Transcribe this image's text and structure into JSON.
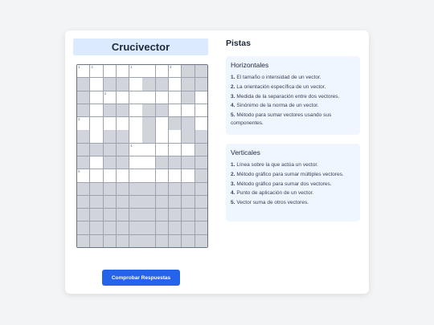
{
  "page": {
    "title": "Crucivector",
    "check_button_label": "Comprobar Respuestas"
  },
  "crossword": {
    "rows": 14,
    "cols": 10,
    "layout": [
      "WWWWWWWWGG",
      "GWGGWGGWGG",
      "GWWWWWWWGW",
      "GWGGWGGWWW",
      "WWWWWGWGGW",
      "GWGGWGWWGG",
      "GGGGWWWWWG",
      "GWGGWWGGGG",
      "WWWWWWWWWG",
      "GGGGGGGGGG",
      "GGGGGGGGGG",
      "GGGGGGGGGG",
      "GGGGGGGGGG",
      "GGGGGGGGGG"
    ],
    "numbers": [
      {
        "row": 0,
        "col": 0,
        "n": "1"
      },
      {
        "row": 0,
        "col": 1,
        "n": "4"
      },
      {
        "row": 0,
        "col": 4,
        "n": "1"
      },
      {
        "row": 0,
        "col": 7,
        "n": "3"
      },
      {
        "row": 2,
        "col": 2,
        "n": "2"
      },
      {
        "row": 4,
        "col": 0,
        "n": "3"
      },
      {
        "row": 6,
        "col": 4,
        "n": "4"
      },
      {
        "row": 8,
        "col": 0,
        "n": "5"
      }
    ]
  },
  "clues_panel": {
    "title": "Pistas",
    "horizontal": {
      "title": "Horizontales",
      "items": [
        {
          "n": "1.",
          "text": "El tamaño o intensidad de un vector."
        },
        {
          "n": "2.",
          "text": "La orientación específica de un vector."
        },
        {
          "n": "3.",
          "text": "Medida de la separación entre dos vectores."
        },
        {
          "n": "4.",
          "text": "Sinónimo de la norma de un vector."
        },
        {
          "n": "5.",
          "text": "Método para sumar vectores usando sus componentes."
        }
      ]
    },
    "vertical": {
      "title": "Verticales",
      "items": [
        {
          "n": "1.",
          "text": "Línea sobre la que actúa un vector."
        },
        {
          "n": "2.",
          "text": "Método gráfico para sumar múltiples vectores."
        },
        {
          "n": "3.",
          "text": "Método gráfico para sumar dos vectores."
        },
        {
          "n": "4.",
          "text": "Punto de aplicación de un vector."
        },
        {
          "n": "5.",
          "text": "Vector suma de otros vectores."
        }
      ]
    }
  },
  "colors": {
    "accent": "#2563eb",
    "title_bg": "#dbeafe",
    "panel_bg": "#eff6ff",
    "cell_blocked": "#d1d5db",
    "cell_open": "#ffffff"
  }
}
